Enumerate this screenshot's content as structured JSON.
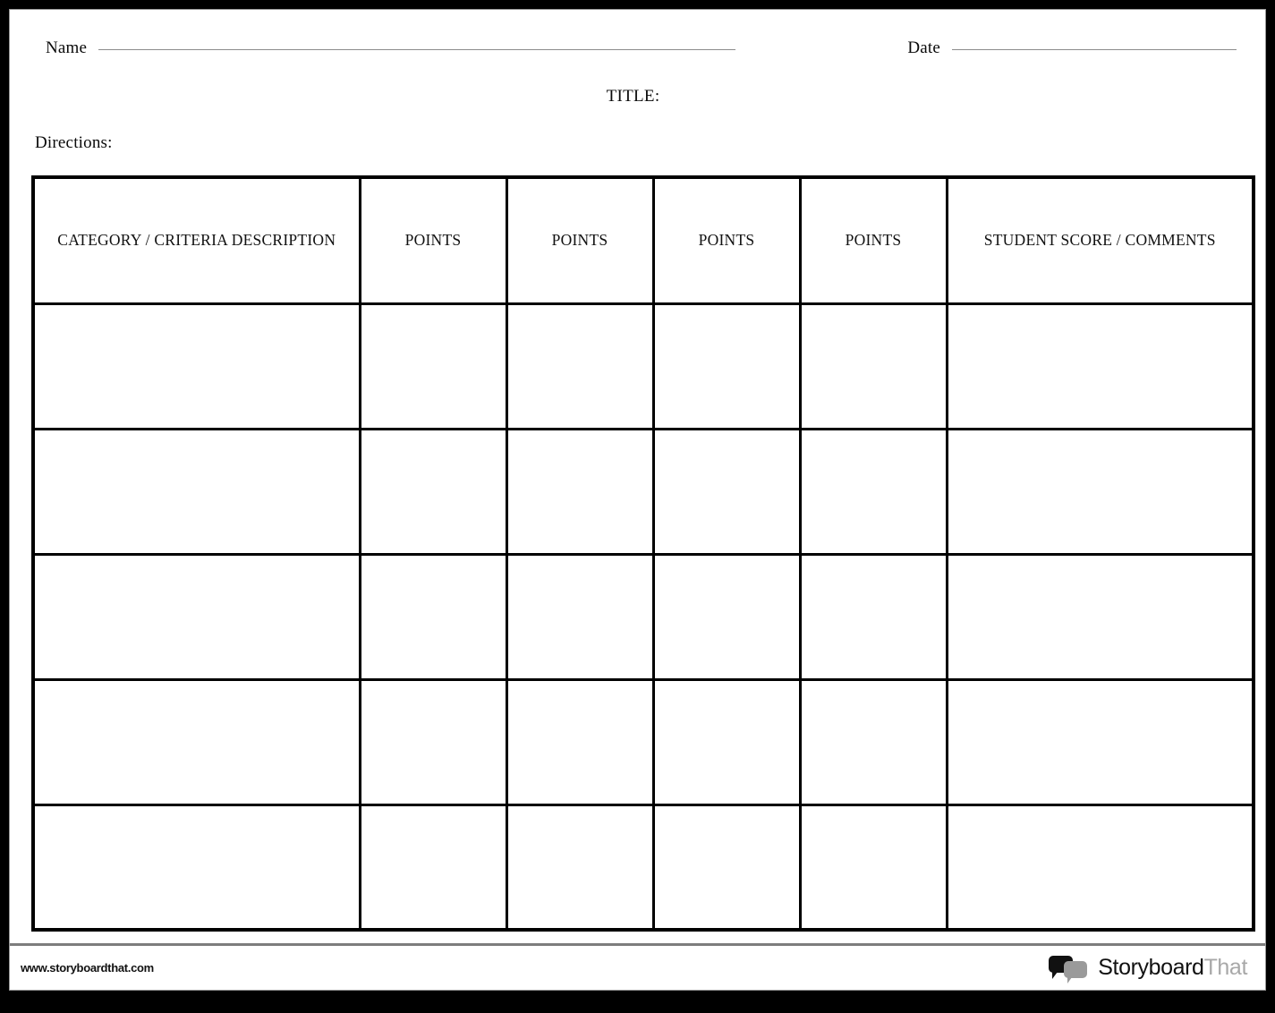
{
  "document": {
    "kind": "rubric-worksheet-template",
    "title_label": "TITLE:",
    "directions_label": "Directions:"
  },
  "header": {
    "name_label": "Name",
    "date_label": "Date"
  },
  "table": {
    "columns": [
      "CATEGORY / CRITERIA DESCRIPTION",
      "POINTS",
      "POINTS",
      "POINTS",
      "POINTS",
      "STUDENT SCORE / COMMENTS"
    ],
    "rows": [
      [
        "",
        "",
        "",
        "",
        "",
        ""
      ],
      [
        "",
        "",
        "",
        "",
        "",
        ""
      ],
      [
        "",
        "",
        "",
        "",
        "",
        ""
      ],
      [
        "",
        "",
        "",
        "",
        "",
        ""
      ],
      [
        "",
        "",
        "",
        "",
        "",
        ""
      ]
    ]
  },
  "footer": {
    "url": "www.storyboardthat.com",
    "brand_primary": "Storyboard",
    "brand_secondary": "That",
    "logo_icon": "speech-bubbles-icon"
  },
  "colors": {
    "frame": "#000000",
    "sheet": "#ffffff",
    "table_border": "#000000",
    "rule": "#8c8c8c",
    "brand_dark": "#111111",
    "brand_light": "#a8a8a8"
  }
}
